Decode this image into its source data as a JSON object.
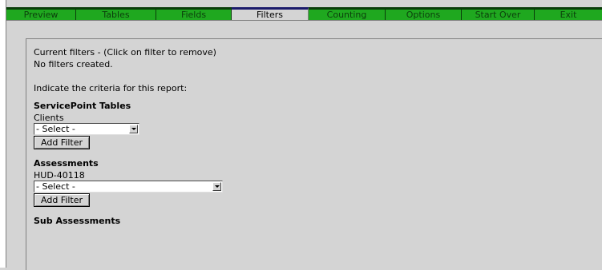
{
  "nav": {
    "tabs": [
      {
        "label": "Preview"
      },
      {
        "label": "Tables"
      },
      {
        "label": "Fields"
      },
      {
        "label": "Filters"
      },
      {
        "label": "Counting"
      },
      {
        "label": "Options"
      },
      {
        "label": "Start Over"
      },
      {
        "label": "Exit"
      }
    ],
    "active": "Filters"
  },
  "filters": {
    "current_label": "Current filters - (Click on filter to remove)",
    "status": "No filters created.",
    "instruction": "Indicate the criteria for this report:"
  },
  "servicepoint": {
    "heading": "ServicePoint Tables",
    "label": "Clients",
    "select_value": "- Select -",
    "button": "Add Filter"
  },
  "assessments": {
    "heading": "Assessments",
    "label": "HUD-40118",
    "select_value": "- Select -",
    "button": "Add Filter"
  },
  "sub_assessments": {
    "heading": "Sub Assessments"
  },
  "colors": {
    "tab_green": "#1fa81f",
    "background": "#d4d4d4"
  }
}
